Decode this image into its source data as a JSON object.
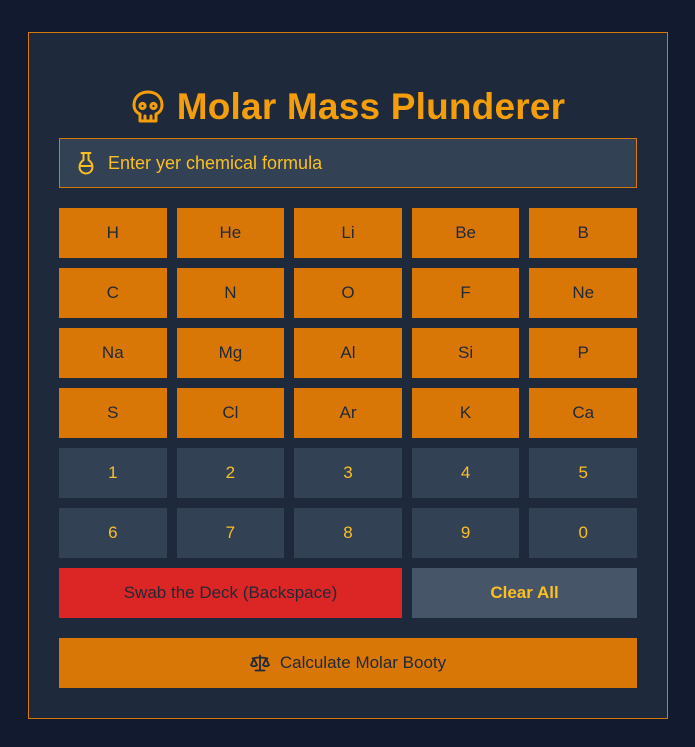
{
  "header": {
    "title": "Molar Mass Plunderer",
    "icon": "skull-icon"
  },
  "formula_input": {
    "placeholder": "Enter yer chemical formula",
    "value": "",
    "icon": "flask-icon"
  },
  "element_keys": [
    "H",
    "He",
    "Li",
    "Be",
    "B",
    "C",
    "N",
    "O",
    "F",
    "Ne",
    "Na",
    "Mg",
    "Al",
    "Si",
    "P",
    "S",
    "Cl",
    "Ar",
    "K",
    "Ca"
  ],
  "number_keys": [
    "1",
    "2",
    "3",
    "4",
    "5",
    "6",
    "7",
    "8",
    "9",
    "0"
  ],
  "actions": {
    "backspace_label": "Swab the Deck (Backspace)",
    "clear_label": "Clear All",
    "calculate_label": "Calculate Molar Booty",
    "calculate_icon": "scale-icon"
  },
  "colors": {
    "background": "#111a2e",
    "panel": "#1e293b",
    "accent": "#f59e0b",
    "element_key": "#d97706",
    "number_key": "#334155",
    "danger": "#dc2626",
    "secondary": "#475569"
  }
}
